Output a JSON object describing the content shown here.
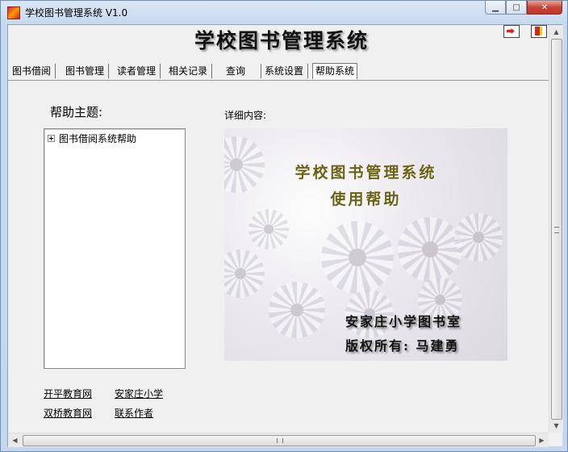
{
  "window": {
    "title": "学校图书管理系统  V1.0",
    "minimize_glyph": "▁",
    "maximize_glyph": "□",
    "close_glyph": "✕"
  },
  "app": {
    "heading": "学校图书管理系统"
  },
  "toolbar": {
    "exit_icon": "exit-icon",
    "help_icon": "help-book-icon"
  },
  "tabs": [
    {
      "label": "图书借阅"
    },
    {
      "label": "图书管理"
    },
    {
      "label": "读者管理"
    },
    {
      "label": "相关记录"
    },
    {
      "label": "查询"
    },
    {
      "label": "系统设置"
    },
    {
      "label": "帮助系统",
      "active": true
    }
  ],
  "help": {
    "subject_label": "帮助主题:",
    "tree_root": "图书借阅系统帮助",
    "detail_label": "详细内容:",
    "image_title_line1": "学校图书管理系统",
    "image_title_line2": "使用帮助",
    "image_footer_line1": "安家庄小学图书室",
    "image_footer_line2": "版权所有: 马建勇"
  },
  "links": [
    {
      "label": "开平教育网"
    },
    {
      "label": "安家庄小学"
    },
    {
      "label": "双桥教育网"
    },
    {
      "label": "联系作者"
    }
  ],
  "scroll": {
    "up": "▲",
    "down": "▼",
    "left": "◀",
    "right": "▶"
  },
  "colors": {
    "title_gold": "#6a6214",
    "window_frame": "#b9d1ea",
    "client_bg": "#f0f0f0"
  }
}
